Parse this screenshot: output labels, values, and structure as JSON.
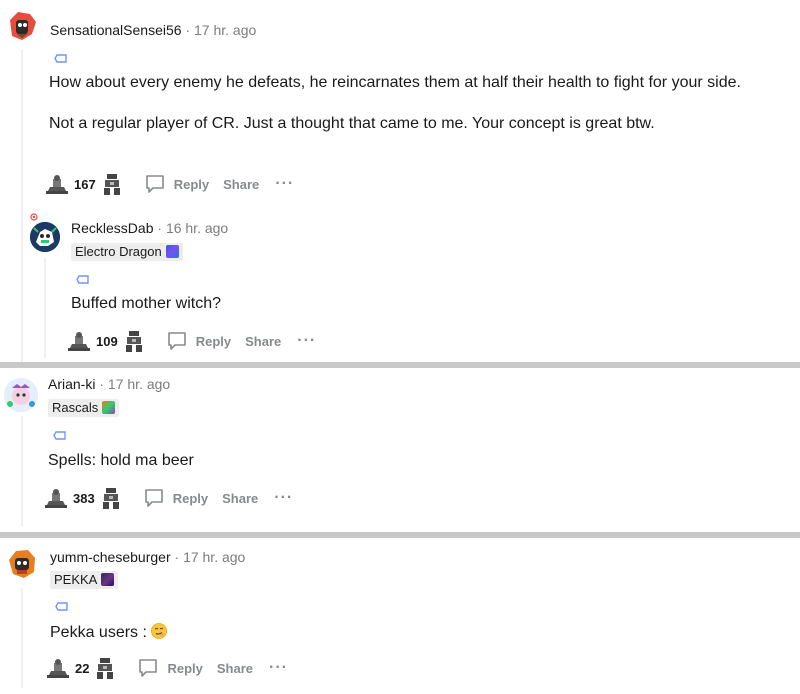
{
  "comments": [
    {
      "username": "SensationalSensei56",
      "time": "17 hr. ago",
      "flair": null,
      "body": [
        "How about every enemy he defeats, he reincarnates them at half their health to fight for your side.",
        "Not a regular player of CR. Just a thought that came to me. Your concept is great btw."
      ],
      "score": "167",
      "reply_label": "Reply",
      "share_label": "Share",
      "more_label": "···"
    },
    {
      "username": "RecklessDab",
      "time": "16 hr. ago",
      "flair": "Electro Dragon",
      "body": [
        "Buffed mother witch?"
      ],
      "score": "109",
      "reply_label": "Reply",
      "share_label": "Share",
      "more_label": "···"
    },
    {
      "username": "Arian-ki",
      "time": "17 hr. ago",
      "flair": "Rascals",
      "body": [
        "Spells: hold ma beer"
      ],
      "score": "383",
      "reply_label": "Reply",
      "share_label": "Share",
      "more_label": "···"
    },
    {
      "username": "yumm-cheseburger",
      "time": "17 hr. ago",
      "flair": "PEKKA",
      "body": [
        "Pekka users : "
      ],
      "score": "22",
      "reply_label": "Reply",
      "share_label": "Share",
      "more_label": "···"
    }
  ],
  "separator": "·",
  "icons": {
    "upvote": "upvote-icon",
    "downvote": "downvote-icon",
    "reply": "reply-icon",
    "award": "award-tag-icon"
  },
  "colors": {
    "text": "#1a1a1b",
    "muted": "#7c7c7c",
    "action": "#878a8c",
    "tag": "#7193ff",
    "separator": "#c8c8c8"
  }
}
